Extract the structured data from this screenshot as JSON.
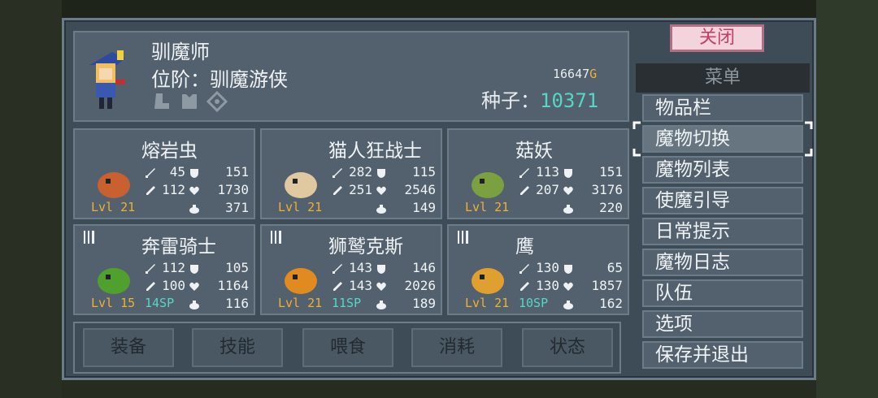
{
  "close_button": "关闭",
  "menu": {
    "header": "菜单",
    "items": [
      "物品栏",
      "魔物切换",
      "魔物列表",
      "使魔引导",
      "日常提示",
      "魔物日志",
      "队伍",
      "选项",
      "保存并退出"
    ],
    "selected_index": 1
  },
  "player": {
    "class": "驯魔师",
    "rank": "位阶：驯魔游侠",
    "gold": "16647",
    "gold_unit": "G",
    "seeds_label": "种子：",
    "seeds": "10371"
  },
  "monsters": [
    {
      "name": "熔岩虫",
      "atk": "45",
      "def": "151",
      "matk": "112",
      "hp": "1730",
      "food": "371",
      "level": "Lvl 21",
      "sp": "",
      "forkable": false
    },
    {
      "name": "猫人狂战士",
      "atk": "282",
      "def": "115",
      "matk": "251",
      "hp": "2546",
      "food": "149",
      "level": "Lvl 21",
      "sp": "",
      "forkable": false
    },
    {
      "name": "菇妖",
      "atk": "113",
      "def": "151",
      "matk": "207",
      "hp": "3176",
      "food": "220",
      "level": "Lvl 21",
      "sp": "",
      "forkable": false
    },
    {
      "name": "奔雷骑士",
      "atk": "112",
      "def": "105",
      "matk": "100",
      "hp": "1164",
      "food": "116",
      "level": "Lvl 15",
      "sp": "14SP",
      "forkable": true
    },
    {
      "name": "狮鹫克斯",
      "atk": "143",
      "def": "146",
      "matk": "143",
      "hp": "2026",
      "food": "189",
      "level": "Lvl 21",
      "sp": "11SP",
      "forkable": true
    },
    {
      "name": "鹰",
      "atk": "130",
      "def": "65",
      "matk": "130",
      "hp": "1857",
      "food": "162",
      "level": "Lvl 21",
      "sp": "10SP",
      "forkable": true
    }
  ],
  "bottom_buttons": [
    "装备",
    "技能",
    "喂食",
    "消耗",
    "状态"
  ],
  "colors": {
    "gold": "#f0b030",
    "seeds": "#56d6c8",
    "sp": "#56d6c8",
    "panel": "#3e4c58",
    "box": "#52616d"
  }
}
